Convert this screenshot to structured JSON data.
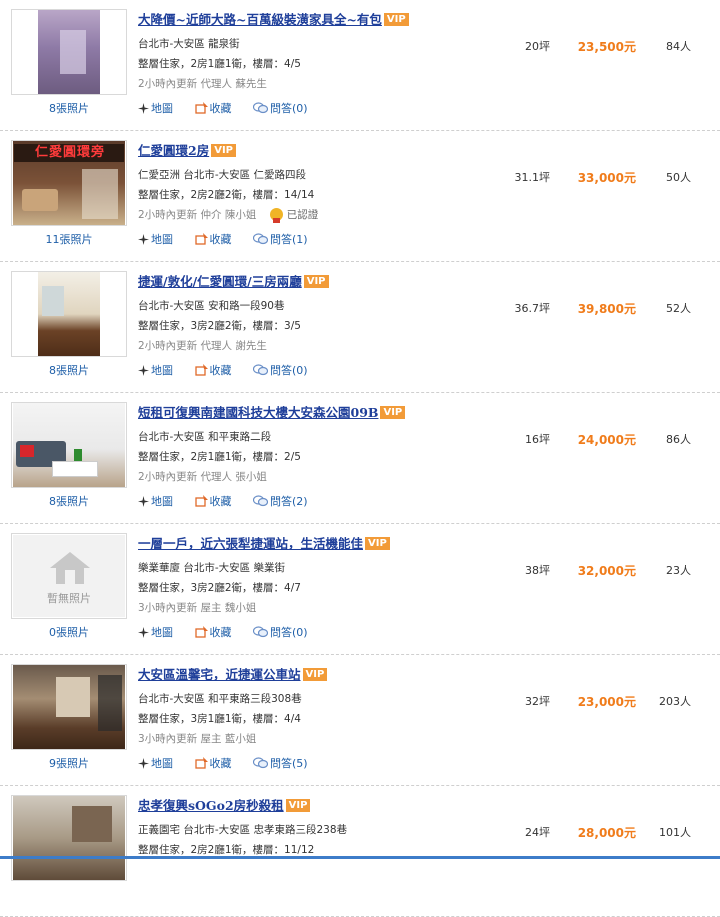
{
  "listings": [
    {
      "title": "大降價~近師大路~百萬級裝潢家具全~有包",
      "vip": "VIP",
      "line1": "台北市-大安區 龍泉街",
      "line2": "整層住家，2房1廳1衛，樓層：4/5",
      "line3": "2小時內更新 代理人 蘇先生",
      "cert": "",
      "photo_count": "8張照片",
      "map": "地圖",
      "fav": "收藏",
      "qa": "問答(0)",
      "size": "20坪",
      "price": "23,500元",
      "viewers": "84人"
    },
    {
      "title": "仁愛圓環2房",
      "vip": "VIP",
      "line1": "仁愛亞洲 台北市-大安區 仁愛路四段",
      "line2": "整層住家，2房2廳2衛，樓層：14/14",
      "line3": "2小時內更新 仲介 陳小姐",
      "cert": "已認證",
      "photo_count": "11張照片",
      "map": "地圖",
      "fav": "收藏",
      "qa": "問答(1)",
      "size": "31.1坪",
      "price": "33,000元",
      "viewers": "50人",
      "banner": "仁愛圓環旁"
    },
    {
      "title": "捷運/敦化/仁愛圓環/三房兩廳",
      "vip": "VIP",
      "line1": "台北市-大安區 安和路一段90巷",
      "line2": "整層住家，3房2廳2衛，樓層：3/5",
      "line3": "2小時內更新 代理人 謝先生",
      "cert": "",
      "photo_count": "8張照片",
      "map": "地圖",
      "fav": "收藏",
      "qa": "問答(0)",
      "size": "36.7坪",
      "price": "39,800元",
      "viewers": "52人"
    },
    {
      "title": "短租可復興南建國科技大樓大安森公園09B",
      "vip": "VIP",
      "line1": "台北市-大安區 和平東路二段",
      "line2": "整層住家，2房1廳1衛，樓層：2/5",
      "line3": "2小時內更新 代理人 張小姐",
      "cert": "",
      "photo_count": "8張照片",
      "map": "地圖",
      "fav": "收藏",
      "qa": "問答(2)",
      "size": "16坪",
      "price": "24,000元",
      "viewers": "86人"
    },
    {
      "title": "一層一戶，近六張犁捷運站，生活機能佳",
      "vip": "VIP",
      "line1": "樂業華廈 台北市-大安區 樂業街",
      "line2": "整層住家，3房2廳2衛，樓層：4/7",
      "line3": "3小時內更新 屋主 魏小姐",
      "cert": "",
      "photo_count": "0張照片",
      "no_photo_label": "暫無照片",
      "map": "地圖",
      "fav": "收藏",
      "qa": "問答(0)",
      "size": "38坪",
      "price": "32,000元",
      "viewers": "23人"
    },
    {
      "title": "大安區溫馨宅，近捷運公車站",
      "vip": "VIP",
      "line1": "台北市-大安區 和平東路三段308巷",
      "line2": "整層住家，3房1廳1衛，樓層：4/4",
      "line3": "3小時內更新 屋主 藍小姐",
      "cert": "",
      "photo_count": "9張照片",
      "map": "地圖",
      "fav": "收藏",
      "qa": "問答(5)",
      "size": "32坪",
      "price": "23,000元",
      "viewers": "203人"
    },
    {
      "title": "忠孝復興sOGo2房秒殺租",
      "vip": "VIP",
      "line1": "正義園宅 台北市-大安區 忠孝東路三段238巷",
      "line2": "整層住家，2房2廳1衛，樓層：11/12",
      "line3": "",
      "cert": "",
      "photo_count": "",
      "map": "",
      "fav": "",
      "qa": "",
      "size": "24坪",
      "price": "28,000元",
      "viewers": "101人"
    }
  ],
  "colors": {
    "title": "#1f3f9a",
    "price": "#f07c1b",
    "vip": "#f29b38",
    "link": "#1f5fa8"
  }
}
